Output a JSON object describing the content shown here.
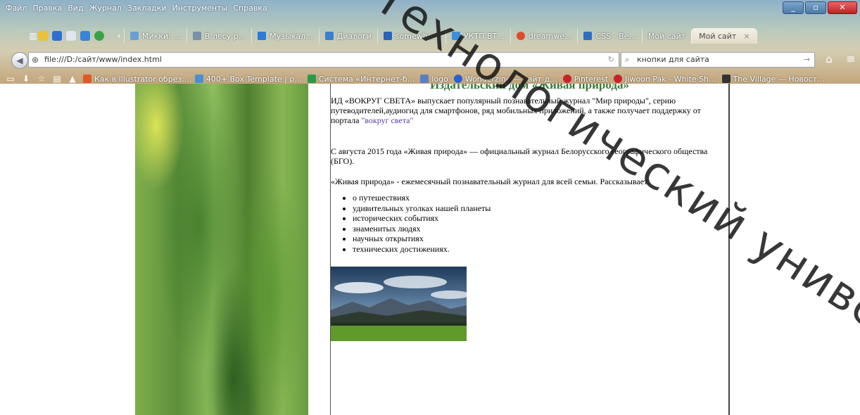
{
  "browser": {
    "menu": [
      "Файл",
      "Правка",
      "Вид",
      "Журнал",
      "Закладки",
      "Инструменты",
      "Справка"
    ],
    "tabs": [
      {
        "label": "Микки: ...",
        "color": "#6a9fd6"
      },
      {
        "label": "В лесу р...",
        "color": "#7b8fa6"
      },
      {
        "label": "Музыкал...",
        "color": "#2c7bd6"
      },
      {
        "label": "Диалоги",
        "color": "#3a7fd0"
      },
      {
        "label": "somewhe...",
        "color": "#2a62b8"
      },
      {
        "label": "УКТП ВТ...",
        "color": "#3b8fe0"
      },
      {
        "label": "dreamwe...",
        "color": "#e04a2a"
      },
      {
        "label": "CSS - Be...",
        "color": "#2f6fc0"
      },
      {
        "label": "Мой сайт",
        "color": "#c9b88a"
      },
      {
        "label": "Мой сайт",
        "color": "#e4dcc9"
      }
    ],
    "tab_close": "×",
    "url": "file:///D:/сайт/www/index.html",
    "search_value": "кнопки для сайта",
    "bookmarks": [
      {
        "label": "Как в illustrator обрез...",
        "color": "#e0582a"
      },
      {
        "label": "400+ Box Template | p...",
        "color": "#4a8fd0"
      },
      {
        "label": "Система «Интернет-б...",
        "color": "#2a9a4a"
      },
      {
        "label": "logo",
        "color": "#5a7fc0"
      },
      {
        "label": "Wonderzine — сайт д...",
        "color": "#2a5fd0"
      },
      {
        "label": "Pinterest",
        "color": "#c8232c"
      },
      {
        "label": "Jiwoon Pak - White Sh...",
        "color": "#c8232c"
      },
      {
        "label": "The Village — Новост...",
        "color": "#333333"
      }
    ],
    "watermark": "Технологический универс"
  },
  "page": {
    "title": "Издательский дом «Живая природа»",
    "intro_text": "ИД «ВОКРУГ СВЕТА» выпускает популярный познавательный журнал \"Мир природы\", серию путеводителей,аудиогид для смартфонов, ряд мобильных приложений, а также получает поддержку от портала ",
    "intro_link": "\"вокруг света\"",
    "para2": "С августа 2015 года «Живая природа» — официальный журнал Белорусского географического общества (БГО).",
    "para3": "«Живая природа» - ежемесячный познавательный журнал для всей семьи. Рассказывает:",
    "topics": [
      "о путешествиях",
      "удивительных уголках нашей планеты",
      "исторических событиях",
      "знаменитых людях",
      "научных открытиях",
      "технических достижениях."
    ]
  }
}
